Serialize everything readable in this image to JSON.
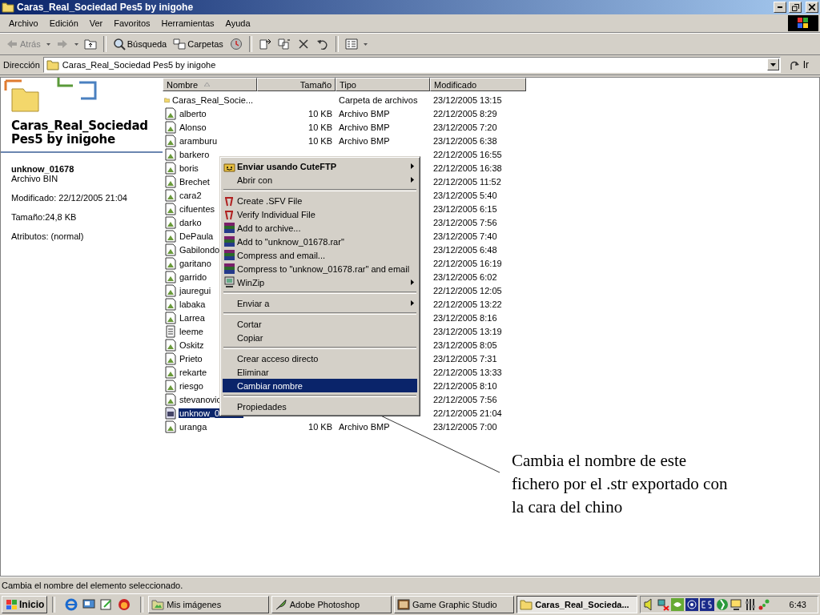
{
  "window": {
    "title": "Caras_Real_Sociedad Pes5 by inigohe"
  },
  "menu_bar": [
    "Archivo",
    "Edición",
    "Ver",
    "Favoritos",
    "Herramientas",
    "Ayuda"
  ],
  "toolbar": [
    {
      "kind": "back",
      "label": "Atrás",
      "disabled": true
    },
    {
      "kind": "forward",
      "disabled": true
    },
    {
      "kind": "up",
      "disabled": false
    },
    {
      "kind": "search",
      "label": "Búsqueda",
      "disabled": false
    },
    {
      "kind": "folders",
      "label": "Carpetas",
      "disabled": false
    },
    {
      "kind": "history",
      "disabled": false
    },
    {
      "kind": "move",
      "disabled": false
    },
    {
      "kind": "copy",
      "disabled": false
    },
    {
      "kind": "delete",
      "disabled": false
    },
    {
      "kind": "undo",
      "disabled": false
    },
    {
      "kind": "views",
      "disabled": false
    }
  ],
  "address": {
    "label": "Dirección",
    "value": "Caras_Real_Sociedad Pes5 by inigohe",
    "go": "Ir"
  },
  "side_panel": {
    "folder_title": "Caras_Real_Sociedad Pes5 by inigohe",
    "file_name": "unknow_01678",
    "file_type": "Archivo BIN",
    "modified": "Modificado: 22/12/2005 21:04",
    "size": "Tamaño:24,8 KB",
    "attributes": "Atributos: (normal)"
  },
  "columns": [
    {
      "label": "Nombre",
      "sorted": true
    },
    {
      "label": "Tamaño",
      "sorted": false
    },
    {
      "label": "Tipo",
      "sorted": false
    },
    {
      "label": "Modificado",
      "sorted": false
    }
  ],
  "files": [
    {
      "kind": "folder",
      "name": "Caras_Real_Socie...",
      "type": "Carpeta de archivos",
      "modified": "23/12/2005 13:15",
      "selected": false
    },
    {
      "kind": "bmp",
      "name": "alberto",
      "size": "10 KB",
      "type": "Archivo BMP",
      "modified": "22/12/2005 8:29",
      "selected": false
    },
    {
      "kind": "bmp",
      "name": "Alonso",
      "size": "10 KB",
      "type": "Archivo BMP",
      "modified": "23/12/2005 7:20",
      "selected": false
    },
    {
      "kind": "bmp",
      "name": "aramburu",
      "size": "10 KB",
      "type": "Archivo BMP",
      "modified": "23/12/2005 6:38",
      "selected": false
    },
    {
      "kind": "bmp",
      "name": "barkero",
      "modified": "22/12/2005 16:55",
      "selected": false
    },
    {
      "kind": "bmp",
      "name": "boris",
      "modified": "22/12/2005 16:38",
      "selected": false
    },
    {
      "kind": "bmp",
      "name": "Brechet",
      "modified": "22/12/2005 11:52",
      "selected": false
    },
    {
      "kind": "bmp",
      "name": "cara2",
      "modified": "23/12/2005 5:40",
      "selected": false
    },
    {
      "kind": "bmp",
      "name": "cifuentes",
      "modified": "23/12/2005 6:15",
      "selected": false
    },
    {
      "kind": "bmp",
      "name": "darko",
      "modified": "23/12/2005 7:56",
      "selected": false
    },
    {
      "kind": "bmp",
      "name": "DePaula",
      "modified": "23/12/2005 7:40",
      "selected": false
    },
    {
      "kind": "bmp",
      "name": "Gabilondo",
      "modified": "23/12/2005 6:48",
      "selected": false
    },
    {
      "kind": "bmp",
      "name": "garitano",
      "modified": "22/12/2005 16:19",
      "selected": false
    },
    {
      "kind": "bmp",
      "name": "garrido",
      "modified": "23/12/2005 6:02",
      "selected": false
    },
    {
      "kind": "bmp",
      "name": "jauregui",
      "modified": "22/12/2005 12:05",
      "selected": false
    },
    {
      "kind": "bmp",
      "name": "labaka",
      "modified": "22/12/2005 13:22",
      "selected": false
    },
    {
      "kind": "bmp",
      "name": "Larrea",
      "modified": "23/12/2005 8:16",
      "selected": false
    },
    {
      "kind": "text",
      "name": "leeme",
      "modified": "23/12/2005 13:19",
      "selected": false
    },
    {
      "kind": "bmp",
      "name": "Oskitz",
      "modified": "23/12/2005 8:05",
      "selected": false
    },
    {
      "kind": "bmp",
      "name": "Prieto",
      "modified": "23/12/2005 7:31",
      "selected": false
    },
    {
      "kind": "bmp",
      "name": "rekarte",
      "modified": "22/12/2005 13:33",
      "selected": false
    },
    {
      "kind": "bmp",
      "name": "riesgo",
      "modified": "22/12/2005 8:10",
      "selected": false
    },
    {
      "kind": "bmp",
      "name": "stevanovic",
      "modified": "22/12/2005 7:56",
      "selected": false
    },
    {
      "kind": "bin",
      "name": "unknow_0",
      "modified": "22/12/2005 21:04",
      "selected": true
    },
    {
      "kind": "bmp",
      "name": "uranga",
      "size": "10 KB",
      "type": "Archivo BMP",
      "modified": "23/12/2005 7:00",
      "selected": false
    }
  ],
  "context_menu": [
    {
      "kind": "cuteftp",
      "label": "Enviar usando CuteFTP",
      "bold": true,
      "submenu": true,
      "selected": false
    },
    {
      "kind": "plain",
      "label": "Abrir con",
      "bold": false,
      "submenu": true,
      "selected": false
    },
    {
      "kind": "separator"
    },
    {
      "kind": "sfv",
      "label": "Create .SFV File",
      "bold": false,
      "submenu": false,
      "selected": false
    },
    {
      "kind": "sfv",
      "label": "Verify Individual File",
      "bold": false,
      "submenu": false,
      "selected": false
    },
    {
      "kind": "rar",
      "label": "Add to archive...",
      "bold": false,
      "submenu": false,
      "selected": false
    },
    {
      "kind": "rar",
      "label": "Add to \"unknow_01678.rar\"",
      "bold": false,
      "submenu": false,
      "selected": false
    },
    {
      "kind": "rar",
      "label": "Compress and email...",
      "bold": false,
      "submenu": false,
      "selected": false
    },
    {
      "kind": "rar",
      "label": "Compress to \"unknow_01678.rar\" and email",
      "bold": false,
      "submenu": false,
      "selected": false
    },
    {
      "kind": "winzip",
      "label": "WinZip",
      "bold": false,
      "submenu": true,
      "selected": false
    },
    {
      "kind": "separator"
    },
    {
      "kind": "plain",
      "label": "Enviar a",
      "bold": false,
      "submenu": true,
      "selected": false
    },
    {
      "kind": "separator"
    },
    {
      "kind": "plain",
      "label": "Cortar",
      "bold": false,
      "submenu": false,
      "selected": false
    },
    {
      "kind": "plain",
      "label": "Copiar",
      "bold": false,
      "submenu": false,
      "selected": false
    },
    {
      "kind": "separator"
    },
    {
      "kind": "plain",
      "label": "Crear acceso directo",
      "bold": false,
      "submenu": false,
      "selected": false
    },
    {
      "kind": "plain",
      "label": "Eliminar",
      "bold": false,
      "submenu": false,
      "selected": false
    },
    {
      "kind": "plain",
      "label": "Cambiar nombre",
      "bold": false,
      "submenu": false,
      "selected": true
    },
    {
      "kind": "separator"
    },
    {
      "kind": "plain",
      "label": "Propiedades",
      "bold": false,
      "submenu": false,
      "selected": false
    }
  ],
  "annotation": {
    "text": "Cambia el nombre de este fichero por el .str exportado con la cara del chino"
  },
  "status_bar": {
    "text": "Cambia el nombre del elemento seleccionado."
  },
  "taskbar": {
    "start": "Inicio",
    "tasks": [
      {
        "label": "Mis imágenes",
        "kind": "pictures",
        "selected": false
      },
      {
        "label": "Adobe Photoshop",
        "kind": "photoshop",
        "selected": false
      },
      {
        "label": "Game Graphic Studio",
        "kind": "studio",
        "selected": false
      },
      {
        "label": "Caras_Real_Socieda...",
        "kind": "folder",
        "selected": true
      }
    ],
    "clock": "6:43"
  }
}
